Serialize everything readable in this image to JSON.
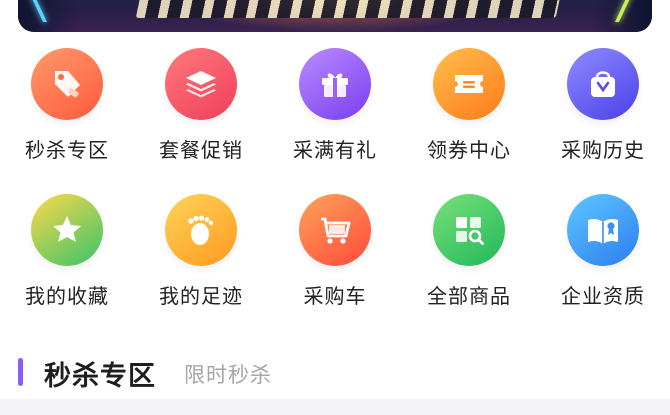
{
  "banner": {
    "pager_total": 3,
    "pager_active": 1
  },
  "nav": {
    "items": [
      {
        "label": "秒杀专区",
        "icon": "tag-icon",
        "color_from": "#ff9a6b",
        "color_to": "#ff5a3c"
      },
      {
        "label": "套餐促销",
        "icon": "layers-icon",
        "color_from": "#ff7a7a",
        "color_to": "#ef3e5c"
      },
      {
        "label": "采满有礼",
        "icon": "gift-icon",
        "color_from": "#b98cff",
        "color_to": "#7a3df0"
      },
      {
        "label": "领券中心",
        "icon": "coupon-icon",
        "color_from": "#ffbf4d",
        "color_to": "#ff7a1a"
      },
      {
        "label": "采购历史",
        "icon": "shopping-bag-icon",
        "color_from": "#8f8cff",
        "color_to": "#4b3fe8"
      },
      {
        "label": "我的收藏",
        "icon": "star-icon",
        "color_from": "#ffd84a",
        "color_to": "#36c46a"
      },
      {
        "label": "我的足迹",
        "icon": "footprint-icon",
        "color_from": "#ffd35a",
        "color_to": "#ff9a1f"
      },
      {
        "label": "采购车",
        "icon": "cart-icon",
        "color_from": "#ffa35a",
        "color_to": "#ff4a3a"
      },
      {
        "label": "全部商品",
        "icon": "grid-search-icon",
        "color_from": "#7be07a",
        "color_to": "#1fb85a"
      },
      {
        "label": "企业资质",
        "icon": "certificate-book-icon",
        "color_from": "#5fc8ff",
        "color_to": "#2b7cf0"
      }
    ]
  },
  "section": {
    "title": "秒杀专区",
    "subtitle": "限时秒杀",
    "accent": "#8a5cf6"
  }
}
